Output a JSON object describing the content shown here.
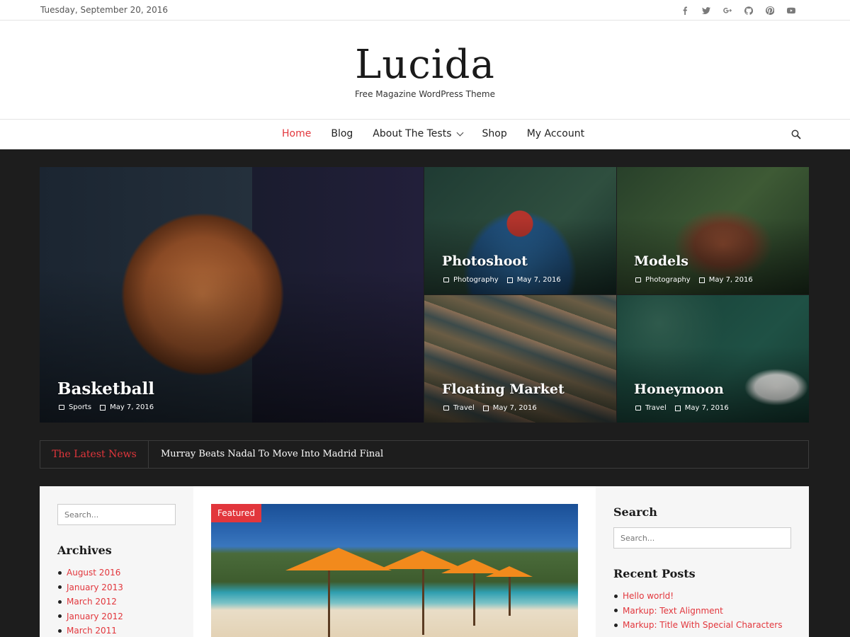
{
  "topbar": {
    "date": "Tuesday, September 20, 2016",
    "social": [
      "facebook-icon",
      "twitter-icon",
      "google-plus-icon",
      "github-icon",
      "pinterest-icon",
      "youtube-icon"
    ]
  },
  "branding": {
    "title": "Lucida",
    "tagline": "Free Magazine WordPress Theme"
  },
  "nav": {
    "items": [
      {
        "label": "Home",
        "active": true
      },
      {
        "label": "Blog"
      },
      {
        "label": "About The Tests",
        "has_dropdown": true
      },
      {
        "label": "Shop"
      },
      {
        "label": "My Account"
      }
    ]
  },
  "featured_posts": [
    {
      "title": "Basketball",
      "category": "Sports",
      "date": "May 7, 2016"
    },
    {
      "title": "Photoshoot",
      "category": "Photography",
      "date": "May 7, 2016"
    },
    {
      "title": "Models",
      "category": "Photography",
      "date": "May 7, 2016"
    },
    {
      "title": "Floating Market",
      "category": "Travel",
      "date": "May 7, 2016"
    },
    {
      "title": "Honeymoon",
      "category": "Travel",
      "date": "May 7, 2016"
    }
  ],
  "latest_news": {
    "label": "The Latest News",
    "headline": "Murray Beats Nadal To Move Into Madrid Final"
  },
  "left_sidebar": {
    "search_placeholder": "Search...",
    "archives_title": "Archives",
    "archives": [
      "August 2016",
      "January 2013",
      "March 2012",
      "January 2012",
      "March 2011"
    ]
  },
  "main": {
    "featured_badge": "Featured"
  },
  "right_sidebar": {
    "search_title": "Search",
    "search_placeholder": "Search...",
    "recent_title": "Recent Posts",
    "recent_posts": [
      "Hello world!",
      "Markup: Text Alignment",
      "Markup: Title With Special Characters"
    ]
  },
  "colors": {
    "accent": "#e2363c",
    "dark_bg": "#1d1d1d"
  }
}
